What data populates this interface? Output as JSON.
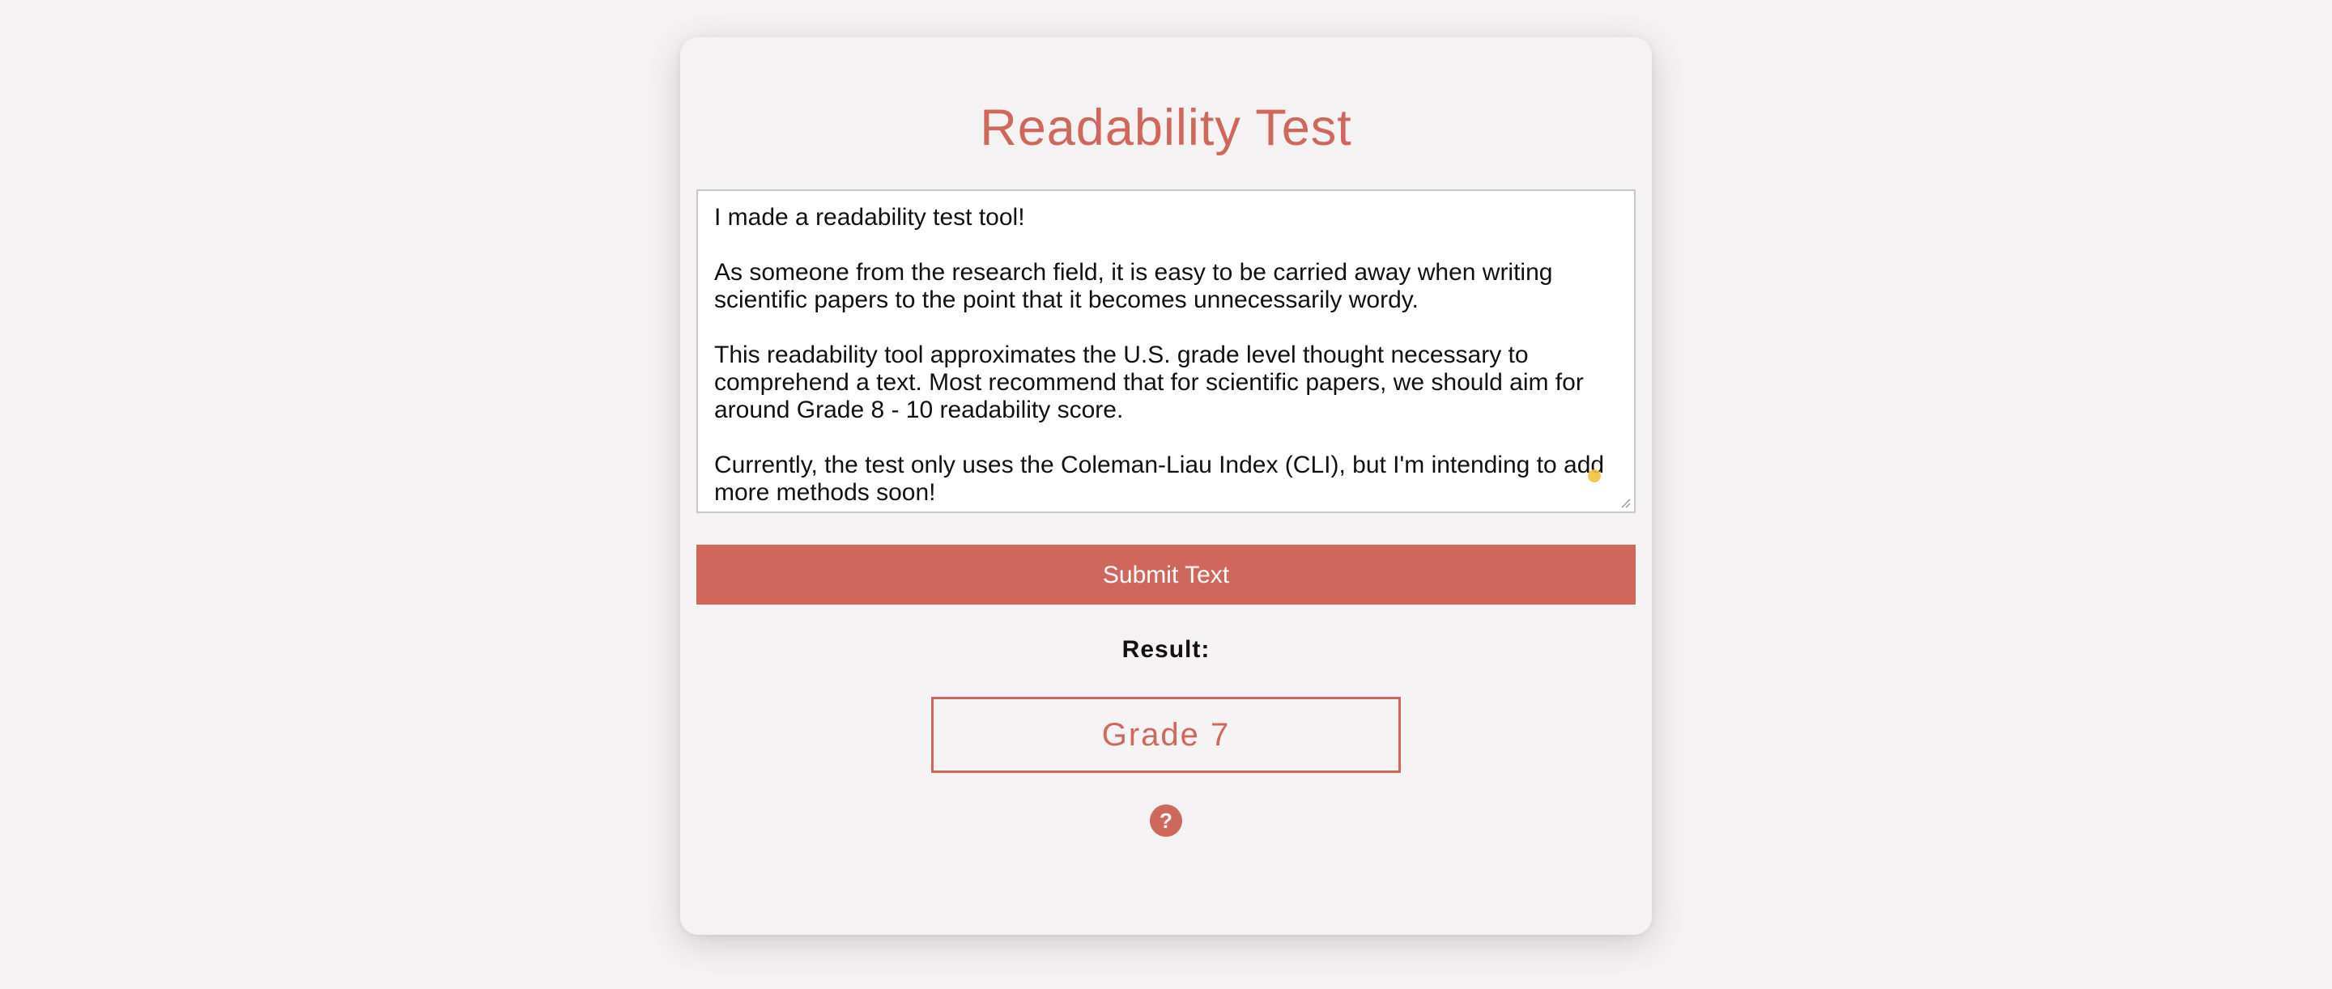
{
  "page": {
    "title": "Readability Test"
  },
  "input": {
    "paragraphs": [
      "I made a readability test tool!",
      "As someone from the research field, it is easy to be carried away when writing scientific papers to the point that it becomes unnecessarily wordy.",
      "This readability tool approximates the U.S. grade level thought necessary to comprehend a text. Most recommend that for scientific papers, we should aim for around Grade 8 - 10 readability score.",
      "Currently, the test only uses the Coleman-Liau Index (CLI), but I'm intending to add more methods soon!"
    ]
  },
  "actions": {
    "submit_label": "Submit Text"
  },
  "result": {
    "label": "Result:",
    "value": "Grade 7"
  },
  "help": {
    "glyph": "?",
    "icon": "question-mark-icon"
  },
  "colors": {
    "accent": "#cf675d",
    "background": "#f4f2f3",
    "text": "#111111"
  }
}
